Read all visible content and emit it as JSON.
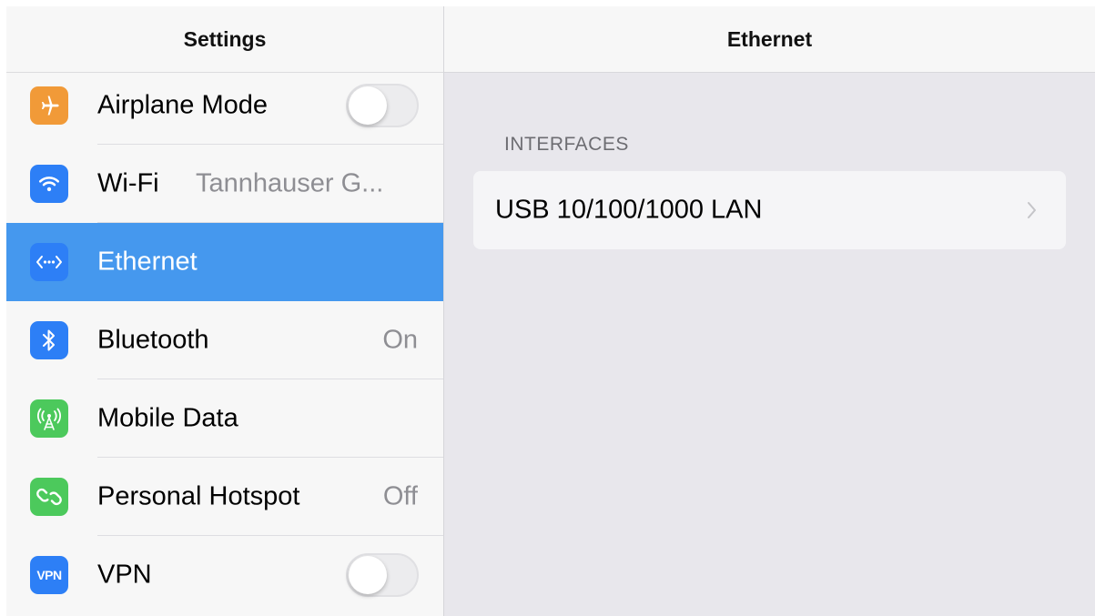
{
  "sidebar": {
    "title": "Settings",
    "items": [
      {
        "label": "Airplane Mode",
        "icon": "airplane-icon",
        "color": "#f19a38",
        "control": "toggle",
        "on": false
      },
      {
        "label": "Wi-Fi",
        "value": "Tannhauser G...",
        "icon": "wifi-icon",
        "color": "#2d7ff6"
      },
      {
        "label": "Ethernet",
        "icon": "ethernet-icon",
        "color": "#2d7ff6",
        "selected": true
      },
      {
        "label": "Bluetooth",
        "value": "On",
        "icon": "bluetooth-icon",
        "color": "#2d7ff6"
      },
      {
        "label": "Mobile Data",
        "icon": "antenna-icon",
        "color": "#4cc95c"
      },
      {
        "label": "Personal Hotspot",
        "value": "Off",
        "icon": "hotspot-icon",
        "color": "#4cc95c"
      },
      {
        "label": "VPN",
        "icon": "vpn-icon",
        "icon_text": "VPN",
        "color": "#2d7ff6",
        "control": "toggle",
        "on": false
      }
    ]
  },
  "detail": {
    "title": "Ethernet",
    "section_header": "INTERFACES",
    "interfaces": [
      {
        "label": "USB 10/100/1000 LAN",
        "icon": "chevron-right-icon"
      }
    ]
  },
  "colors": {
    "selection": "#4598ee",
    "detail_background": "#e8e7ec",
    "sidebar_background": "#f7f7f7"
  }
}
